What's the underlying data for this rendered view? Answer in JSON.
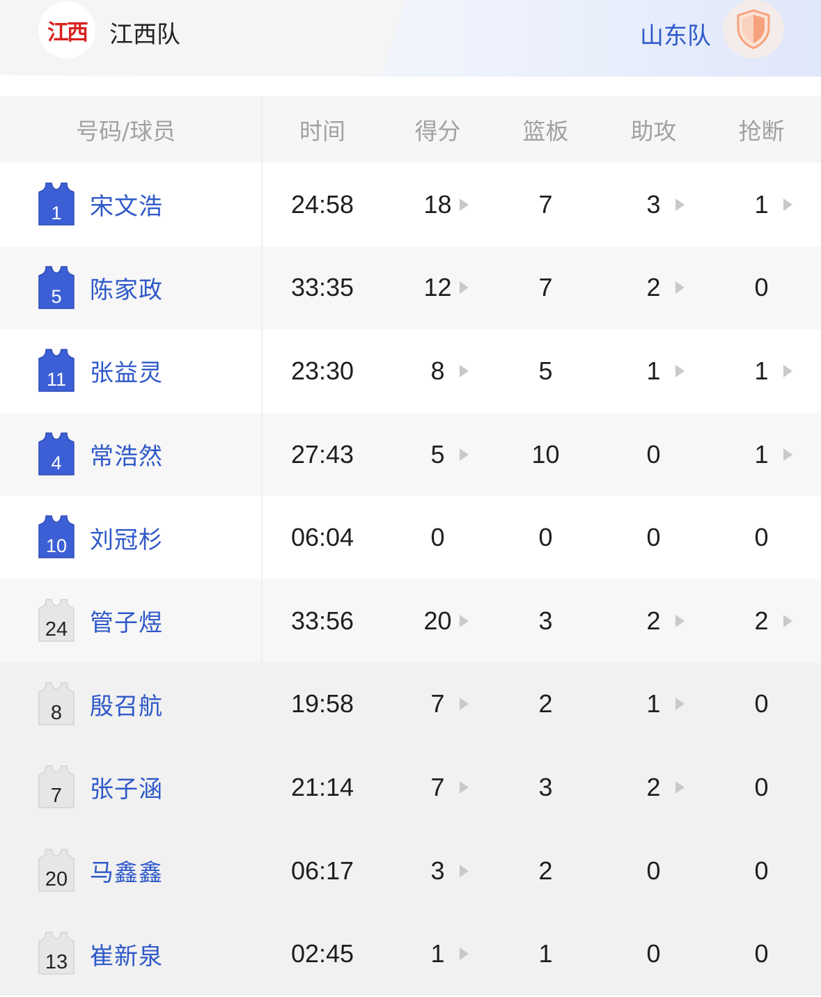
{
  "home_team": {
    "name": "江西队",
    "logo_text": "江西"
  },
  "away_team": {
    "name": "山东队",
    "logo_icon": "shield-icon"
  },
  "table": {
    "headers": [
      "号码/球员",
      "时间",
      "得分",
      "篮板",
      "助攻",
      "抢断"
    ],
    "rows": [
      {
        "number": "1",
        "name": "宋文浩",
        "time": "24:58",
        "pts": "18",
        "reb": "7",
        "ast": "3",
        "stl": "1",
        "starter": true,
        "pts_arrow": true,
        "ast_arrow": true,
        "stl_arrow": true
      },
      {
        "number": "5",
        "name": "陈家政",
        "time": "33:35",
        "pts": "12",
        "reb": "7",
        "ast": "2",
        "stl": "0",
        "starter": true,
        "pts_arrow": true,
        "ast_arrow": true,
        "stl_arrow": false
      },
      {
        "number": "11",
        "name": "张益灵",
        "time": "23:30",
        "pts": "8",
        "reb": "5",
        "ast": "1",
        "stl": "1",
        "starter": true,
        "pts_arrow": true,
        "ast_arrow": true,
        "stl_arrow": true
      },
      {
        "number": "4",
        "name": "常浩然",
        "time": "27:43",
        "pts": "5",
        "reb": "10",
        "ast": "0",
        "stl": "1",
        "starter": true,
        "pts_arrow": true,
        "ast_arrow": false,
        "stl_arrow": true
      },
      {
        "number": "10",
        "name": "刘冠杉",
        "time": "06:04",
        "pts": "0",
        "reb": "0",
        "ast": "0",
        "stl": "0",
        "starter": true,
        "pts_arrow": false,
        "ast_arrow": false,
        "stl_arrow": false
      },
      {
        "number": "24",
        "name": "管子煜",
        "time": "33:56",
        "pts": "20",
        "reb": "3",
        "ast": "2",
        "stl": "2",
        "starter": false,
        "pts_arrow": true,
        "ast_arrow": true,
        "stl_arrow": true
      },
      {
        "number": "8",
        "name": "殷召航",
        "time": "19:58",
        "pts": "7",
        "reb": "2",
        "ast": "1",
        "stl": "0",
        "starter": false,
        "pts_arrow": true,
        "ast_arrow": true,
        "stl_arrow": false
      },
      {
        "number": "7",
        "name": "张子涵",
        "time": "21:14",
        "pts": "7",
        "reb": "3",
        "ast": "2",
        "stl": "0",
        "starter": false,
        "pts_arrow": true,
        "ast_arrow": true,
        "stl_arrow": false
      },
      {
        "number": "20",
        "name": "马鑫鑫",
        "time": "06:17",
        "pts": "3",
        "reb": "2",
        "ast": "0",
        "stl": "0",
        "starter": false,
        "pts_arrow": true,
        "ast_arrow": false,
        "stl_arrow": false
      },
      {
        "number": "13",
        "name": "崔新泉",
        "time": "02:45",
        "pts": "1",
        "reb": "1",
        "ast": "0",
        "stl": "0",
        "starter": false,
        "pts_arrow": true,
        "ast_arrow": false,
        "stl_arrow": false
      }
    ]
  },
  "colors": {
    "accent_blue": "#2f59c9",
    "starter_jersey": "#3d5fd6",
    "sub_jersey": "#e6e6e6",
    "home_logo_red": "#d8231f",
    "away_logo_orange": "#f6a27e"
  }
}
